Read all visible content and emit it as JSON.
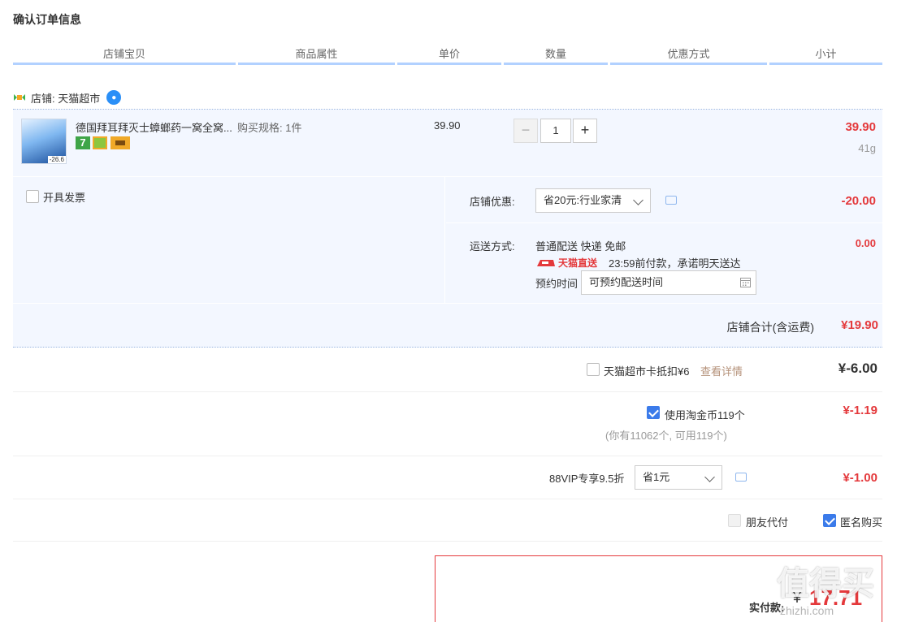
{
  "page_title": "确认订单信息",
  "columns": [
    "店铺宝贝",
    "商品属性",
    "单价",
    "数量",
    "优惠方式",
    "小计"
  ],
  "store": {
    "label": "店铺: 天猫超市"
  },
  "item": {
    "name": "德国拜耳拜灭士蟑螂药一窝全窝...",
    "thumb_badge": "-26.6",
    "spec": "购买规格: 1件",
    "price": "39.90",
    "qty": "1",
    "qty_minus": "−",
    "qty_plus": "+",
    "subtotal": "39.90",
    "weight": "41g",
    "tag7": "7"
  },
  "invoice": {
    "label": "开具发票"
  },
  "shop_discount": {
    "label": "店铺优惠:",
    "selected": "省20元:行业家清",
    "amount": "-20.00"
  },
  "shipping": {
    "label": "运送方式:",
    "method": "普通配送 快递 免邮",
    "amount": "0.00",
    "tmall_direct": "天猫直送",
    "promise": "23:59前付款，承诺明天送达",
    "schedule_label": "预约时间",
    "schedule_placeholder": "可预约配送时间"
  },
  "store_total": {
    "label": "店铺合计(含运费)",
    "value": "¥19.90"
  },
  "card_deduct": {
    "label": "天猫超市卡抵扣¥6",
    "link": "查看详情",
    "amount": "¥-6.00"
  },
  "gold_coin": {
    "label": "使用淘金币119个",
    "note": "(你有11062个, 可用119个)",
    "amount": "¥-1.19"
  },
  "vip": {
    "label": "88VIP专享9.5折",
    "selected": "省1元",
    "amount": "¥-1.00"
  },
  "friend_pay": {
    "label": "朋友代付"
  },
  "anonymous": {
    "label": "匿名购买"
  },
  "pay_box": {
    "label": "实付款:",
    "amount": "17.71",
    "currency": "¥"
  },
  "watermark": {
    "text": "值得买",
    "sub": "zhizhi.com"
  },
  "colors": {
    "accent": "#e4393c",
    "header_line": "#b2d1ff",
    "row_bg": "#f3f7ff",
    "check": "#3b7bea"
  }
}
